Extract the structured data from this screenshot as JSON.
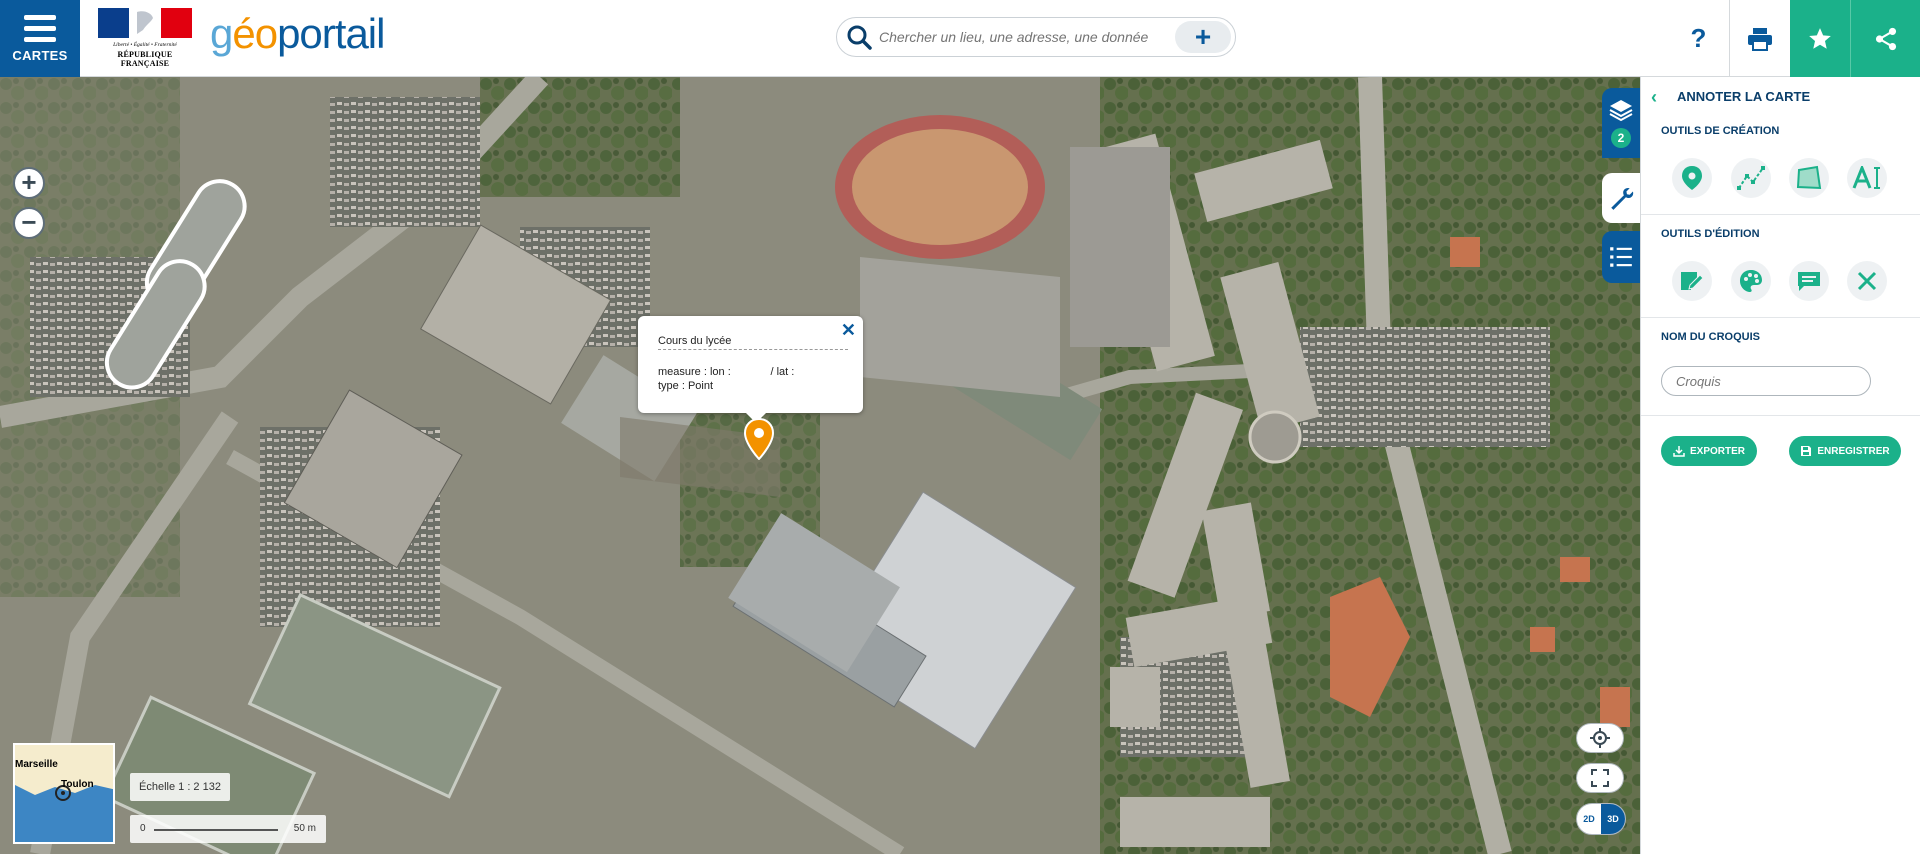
{
  "header": {
    "menu_label": "CARTES",
    "rf_motto": "Liberté • Égalité • Fraternité",
    "rf_name": "RÉPUBLIQUE FRANÇAISE",
    "logo_part1": "g",
    "logo_part2": "éo",
    "logo_part3": "portail",
    "search_placeholder": "Chercher un lieu, une adresse, une donnée",
    "help_label": "?"
  },
  "colors": {
    "primary": "#0a5a9c",
    "accent": "#1bb18a",
    "marker": "#f39200"
  },
  "map": {
    "zoom_in": "+",
    "zoom_out": "−",
    "popup": {
      "title": "Cours du lycée",
      "measure": "measure : lon :             / lat :",
      "type": "type : Point",
      "close": "✕"
    },
    "layer_count": "2",
    "mode_2d": "2D",
    "mode_3d": "3D",
    "overview": {
      "city1": "Marseille",
      "city2": "Toulon"
    },
    "scale_label": "Échelle 1 : 2 132",
    "scale_zero": "0",
    "scale_max": "50 m"
  },
  "panel": {
    "title": "ANNOTER LA CARTE",
    "creation_title": "OUTILS DE CRÉATION",
    "edition_title": "OUTILS D'ÉDITION",
    "name_title": "NOM DU CROQUIS",
    "name_placeholder": "Croquis",
    "export_label": "EXPORTER",
    "save_label": "ENREGISTRER",
    "creation_tools": [
      "point-tool-icon",
      "line-tool-icon",
      "polygon-tool-icon",
      "text-tool-icon"
    ],
    "edition_tools": [
      "edit-icon",
      "palette-icon",
      "label-icon",
      "delete-icon"
    ]
  }
}
